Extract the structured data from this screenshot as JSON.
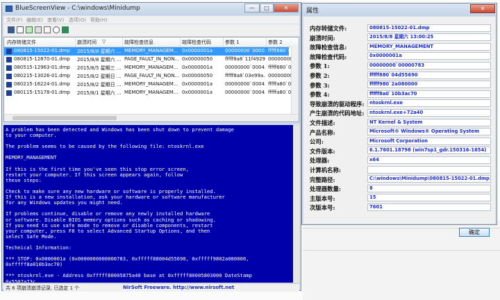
{
  "window": {
    "title": "BlueScreenView - C:\\windows\\Minidump",
    "menu": [
      "文件(F)",
      "编辑(E)",
      "查看(V)",
      "选项(O)",
      "帮助(H)"
    ],
    "buttons": {
      "minimize": "—",
      "maximize": "□",
      "close": "✕"
    }
  },
  "toolbar": {
    "icons": [
      "save-icon",
      "html-report-icon",
      "properties-icon",
      "refresh-icon",
      "copy-icon",
      "find-icon",
      "exit-icon"
    ]
  },
  "list": {
    "columns": [
      "内存转储文件",
      "崩溃时间",
      "故障检查信息",
      "故障检查代码",
      "参数 1",
      "参数 2"
    ],
    "rows": [
      [
        "080815-15022-01.dmp",
        "2015/8/8 星期六 ...",
        "MEMORY_MANAGEM...",
        "0x0000001a",
        "00000000`0000...",
        "fffff880`04d556"
      ],
      [
        "080815-12870-01.dmp",
        "2015/8/8 星期六 ...",
        "PAGE_FAULT_IN_NON...",
        "0x00000050",
        "fffff8a8`11f49290",
        "00000000`0000"
      ],
      [
        "080515-12963-01.dmp",
        "2015/8/5 星期三 ...",
        "MEMORY_MANAGEM...",
        "0x0000001a",
        "00000000`0004...",
        "fffff680`0029ea"
      ],
      [
        "080215-13026-01.dmp",
        "2015/8/2 星期日 ...",
        "PAGE_FAULT_IN_NON...",
        "0x00000050",
        "fffff8a8`03e99a...",
        "00000000`0000"
      ],
      [
        "080215-16224-01.dmp",
        "2015/8/2 星期日 ...",
        "MEMORY_MANAGEM...",
        "0x0000001a",
        "00000000`0004...",
        "fffffa80`00af4a"
      ],
      [
        "080115-15178-01.dmp",
        "2015/8/1 星期六 ...",
        "MEMORY_MANAGEM...",
        "0x0000001a",
        "00000000`0004...",
        "fffffa80`00aa7a"
      ]
    ],
    "selected_index": 0
  },
  "bsod": {
    "text": "A problem has been detected and Windows has been shut down to prevent damage\nto your computer.\n\nThe problem seems to be caused by the following file: ntoskrnl.exe\n\nMEMORY_MANAGEMENT\n\nIf this is the first time you've seen this stop error screen,\nrestart your computer. If this screen appears again, follow\nthese steps:\n\nCheck to make sure any new hardware or software is properly installed.\nIf this is a new installation, ask your hardware or software manufacturer\nfor any Windows updates you might need.\n\nIf problems continue, disable or remove any newly installed hardware\nor software. Disable BIOS memory options such as caching or shadowing.\nIf you need to use safe mode to remove or disable components, restart\nyour computer, press F8 to select Advanced Startup Options, and then\nselect Safe Mode.\n\nTechnical Information:\n\n*** STOP: 0x0000001a (0x0000000000000783, 0xfffff88004d55690, 0xfffff9802a080000,\n0xfffff8a010b3ac70)\n\n*** ntoskrnl.exe - Address 0xfffff80005875a40 base at 0xfffff80005803000 DateStamp\n0x5507a73c"
  },
  "status": {
    "count": "共 6 项崩溃崩溃记录, 已选定 1 个",
    "link": "NirSoft Freeware.  http://www.nirsoft.net"
  },
  "properties": {
    "title": "属性",
    "close": "✕",
    "fields": [
      {
        "label": "内存转储文件:",
        "value": "080815-15022-01.dmp"
      },
      {
        "label": "崩溃时间:",
        "value": "2015/8/8 星期六 13:00:25"
      },
      {
        "label": "故障检查信息:",
        "value": "MEMORY_MANAGEMENT"
      },
      {
        "label": "故障检查代码:",
        "value": "0x0000001a"
      },
      {
        "label": "参数 1:",
        "value": "00000000`00000783"
      },
      {
        "label": "参数 2:",
        "value": "fffff880`04d55690"
      },
      {
        "label": "参数 3:",
        "value": "fffff980`2a080000"
      },
      {
        "label": "参数 4:",
        "value": "fffff8a0`10b3ac70"
      },
      {
        "label": "导致崩溃的驱动程序:",
        "value": "ntoskrnl.exe"
      },
      {
        "label": "产生崩溃的代码地址:",
        "value": "ntoskrnl.exe+72a40"
      },
      {
        "label": "文件描述:",
        "value": "NT Kernel & System"
      },
      {
        "label": "产品名称:",
        "value": "Microsoft® Windows® Operating System"
      },
      {
        "label": "公司:",
        "value": "Microsoft Corporation"
      },
      {
        "label": "文件版本:",
        "value": "6.1.7601.18798 (win7sp1_gdr.150316-1654)"
      },
      {
        "label": "处理器:",
        "value": "x64"
      },
      {
        "label": "计算机名称:",
        "value": ""
      },
      {
        "label": "完整路径:",
        "value": "C:\\windows\\Minidump\\080815-15022-01.dmp"
      },
      {
        "label": "处理器数量:",
        "value": "8"
      },
      {
        "label": "主版本号:",
        "value": "15"
      },
      {
        "label": "次版本号:",
        "value": "7601"
      }
    ],
    "ok": "确定"
  }
}
